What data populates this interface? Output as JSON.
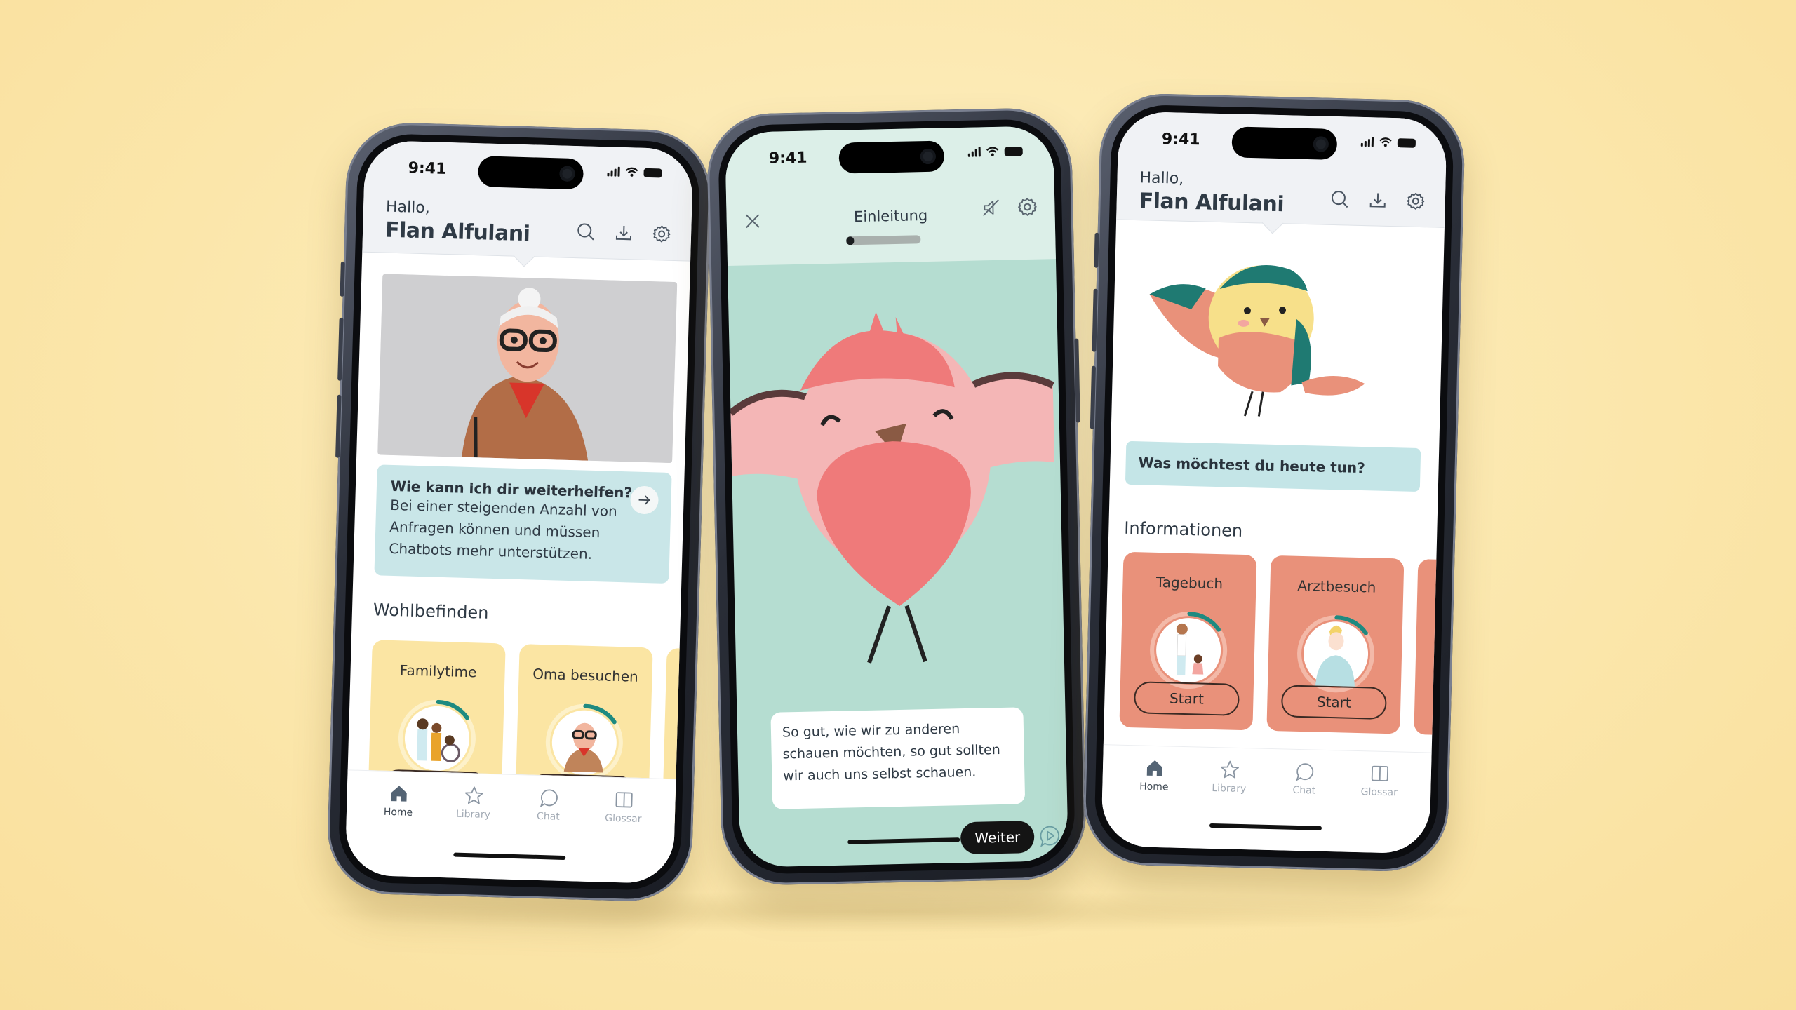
{
  "colors": {
    "background": "#fbe6aa",
    "wellbeing_card": "#fbe5a3",
    "info_card": "#e9917a",
    "help_card": "#c9e6e8",
    "lesson_bg": "#b5ddd1",
    "progress_ring": "#1e8a80"
  },
  "status_bar": {
    "time": "9:41"
  },
  "phones": {
    "left": {
      "header": {
        "greeting": "Hallo,",
        "user_name": "Flan Alfulani"
      },
      "header_icons": [
        "search-icon",
        "download-icon",
        "gear-icon"
      ],
      "help_card": {
        "title": "Wie kann ich dir weiterhelfen?",
        "body": "Bei einer steigenden Anzahl von Anfragen können und müssen Chatbots mehr unterstützen."
      },
      "section_title": "Wohlbefinden",
      "cards": [
        {
          "title": "Familytime",
          "progress": 0.15
        },
        {
          "title": "Oma besuchen",
          "progress": 0.15
        }
      ]
    },
    "middle": {
      "title": "Einleitung",
      "lesson_progress": 0.1,
      "message": "So gut, wie wir zu anderen schauen möchten, so gut sollten wir auch uns selbst schauen.",
      "next_label": "Weiter"
    },
    "right": {
      "header": {
        "greeting": "Hallo,",
        "user_name": "Flan Alfulani"
      },
      "prompt": "Was möchtest du heute tun?",
      "section_title": "Informationen",
      "cards": [
        {
          "title": "Tagebuch",
          "button": "Start",
          "progress": 0.15
        },
        {
          "title": "Arztbesuch",
          "button": "Start",
          "progress": 0.15
        }
      ]
    }
  },
  "tabbar": {
    "tabs": [
      {
        "label": "Home",
        "icon": "home-icon",
        "active": true
      },
      {
        "label": "Library",
        "icon": "star-icon",
        "active": false
      },
      {
        "label": "Chat",
        "icon": "chat-bubble-icon",
        "active": false
      },
      {
        "label": "Glossar",
        "icon": "book-icon",
        "active": false
      }
    ]
  }
}
